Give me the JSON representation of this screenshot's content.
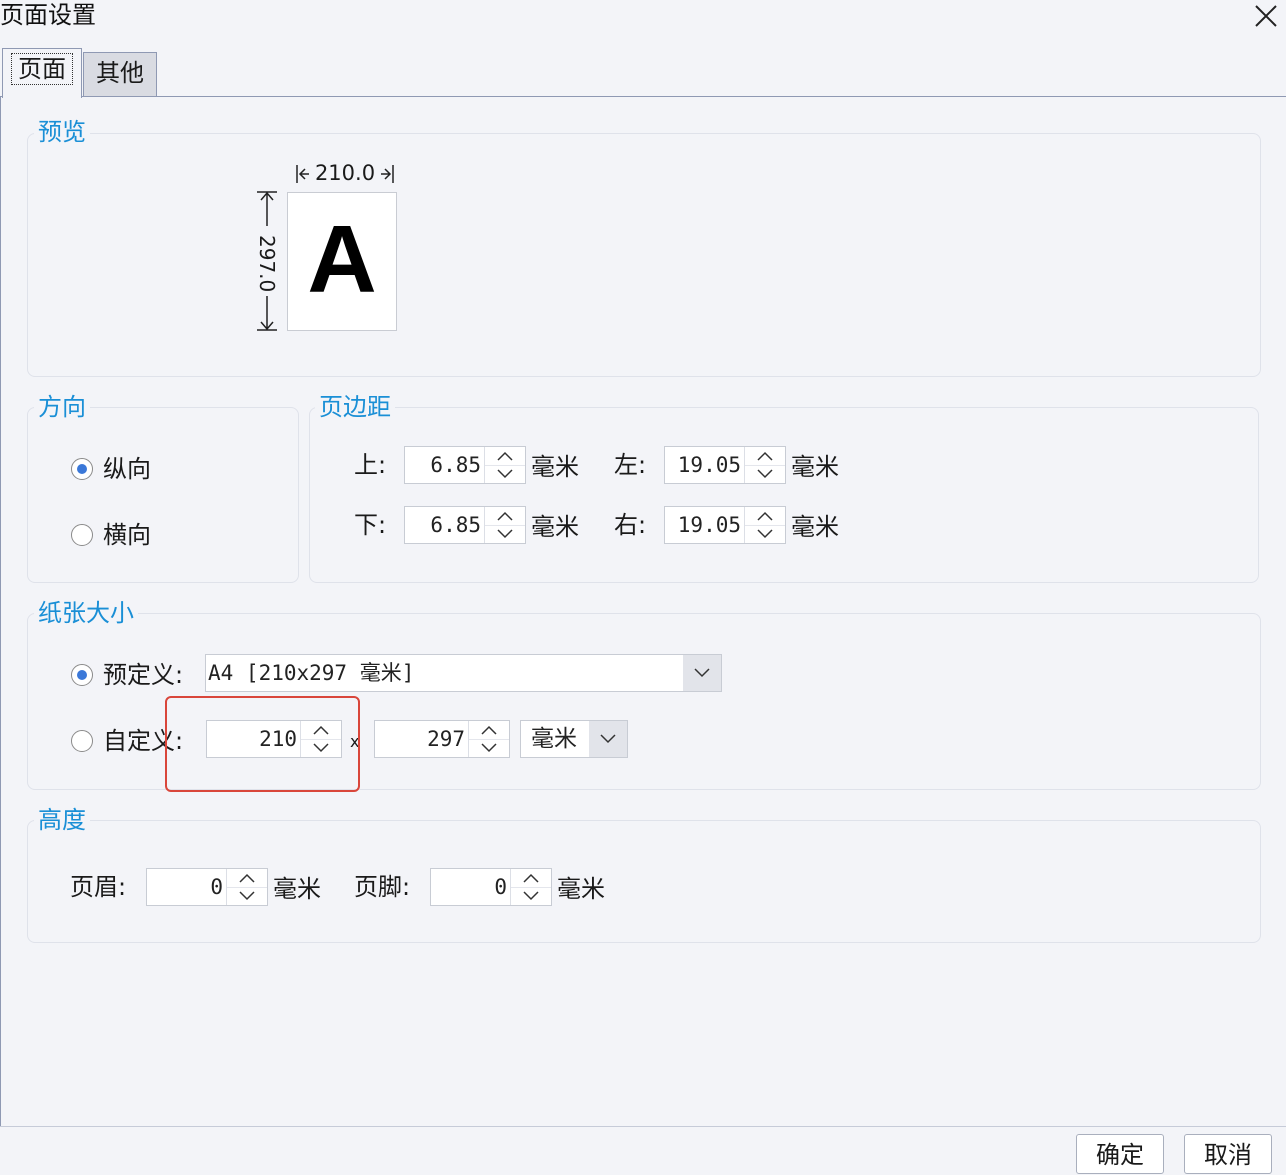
{
  "window": {
    "title": "页面设置"
  },
  "tabs": [
    {
      "label": "页面",
      "active": true
    },
    {
      "label": "其他",
      "active": false
    }
  ],
  "preview": {
    "title": "预览",
    "width_label": "210.0",
    "height_label": "297.0",
    "letter": "A"
  },
  "orientation": {
    "title": "方向",
    "options": [
      {
        "label": "纵向",
        "checked": true
      },
      {
        "label": "横向",
        "checked": false
      }
    ]
  },
  "margins": {
    "title": "页边距",
    "top": {
      "label": "上:",
      "value": "6.85",
      "unit": "毫米"
    },
    "left": {
      "label": "左:",
      "value": "19.05",
      "unit": "毫米"
    },
    "bottom": {
      "label": "下:",
      "value": "6.85",
      "unit": "毫米"
    },
    "right": {
      "label": "右:",
      "value": "19.05",
      "unit": "毫米"
    }
  },
  "paper_size": {
    "title": "纸张大小",
    "predefined": {
      "label": "预定义:",
      "checked": true,
      "value": "A4 [210x297 毫米]"
    },
    "custom": {
      "label": "自定义:",
      "checked": false,
      "width": "210",
      "separator": "x",
      "height": "297",
      "unit": "毫米"
    }
  },
  "height": {
    "title": "高度",
    "header": {
      "label": "页眉:",
      "value": "0",
      "unit": "毫米"
    },
    "footer": {
      "label": "页脚:",
      "value": "0",
      "unit": "毫米"
    }
  },
  "footer_buttons": {
    "ok": "确定",
    "cancel": "取消"
  },
  "colors": {
    "accent": "#1a8fd6",
    "highlight": "#d9463b",
    "radio_dot": "#3b78d8"
  }
}
